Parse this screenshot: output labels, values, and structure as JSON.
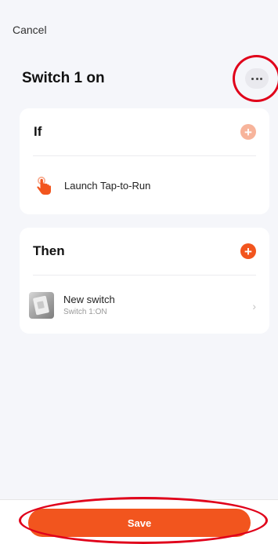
{
  "header": {
    "cancel_label": "Cancel",
    "title": "Switch 1 on",
    "more_icon": "more-horizontal-icon"
  },
  "if_section": {
    "label": "If",
    "add_icon": "plus-icon",
    "condition": {
      "icon": "tap-hand-icon",
      "text": "Launch Tap-to-Run"
    }
  },
  "then_section": {
    "label": "Then",
    "add_icon": "plus-icon",
    "action": {
      "device_name": "New switch",
      "device_status": "Switch 1:ON",
      "chevron": "›"
    }
  },
  "footer": {
    "save_label": "Save"
  },
  "colors": {
    "accent": "#f2551e",
    "accent_light": "#f7b49b",
    "annotation": "#e0001a",
    "background": "#f5f6fa"
  }
}
